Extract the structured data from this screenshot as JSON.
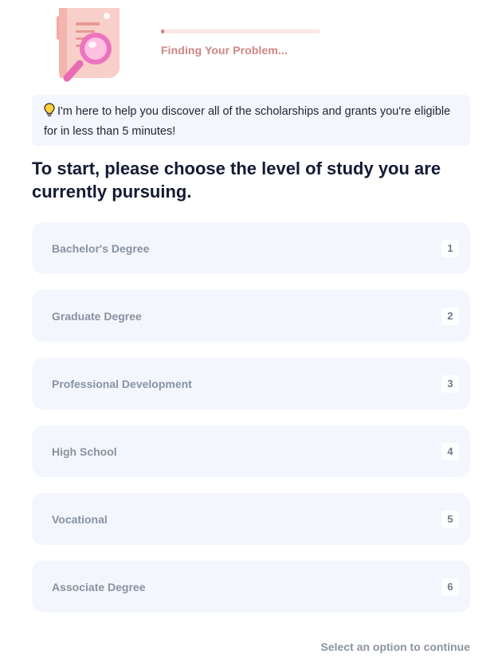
{
  "header": {
    "illustration_icon": "magnifying-glass-over-document",
    "progress_percent": 2,
    "status": "Finding Your Problem..."
  },
  "intro": {
    "icon": "lightbulb-icon",
    "text": "I'm here to help you discover all of the scholarships and grants you're eligible for in less than 5 minutes!"
  },
  "question": "To start, please choose the level of study you are currently pursuing.",
  "options": [
    {
      "label": "Bachelor's Degree",
      "key": "1"
    },
    {
      "label": "Graduate Degree",
      "key": "2"
    },
    {
      "label": "Professional Development",
      "key": "3"
    },
    {
      "label": "High School",
      "key": "4"
    },
    {
      "label": "Vocational",
      "key": "5"
    },
    {
      "label": "Associate Degree",
      "key": "6"
    }
  ],
  "footer": {
    "hint": "Select an option to continue"
  },
  "colors": {
    "accent": "#d08585",
    "card": "#f3f6fd",
    "heading": "#141a33"
  }
}
